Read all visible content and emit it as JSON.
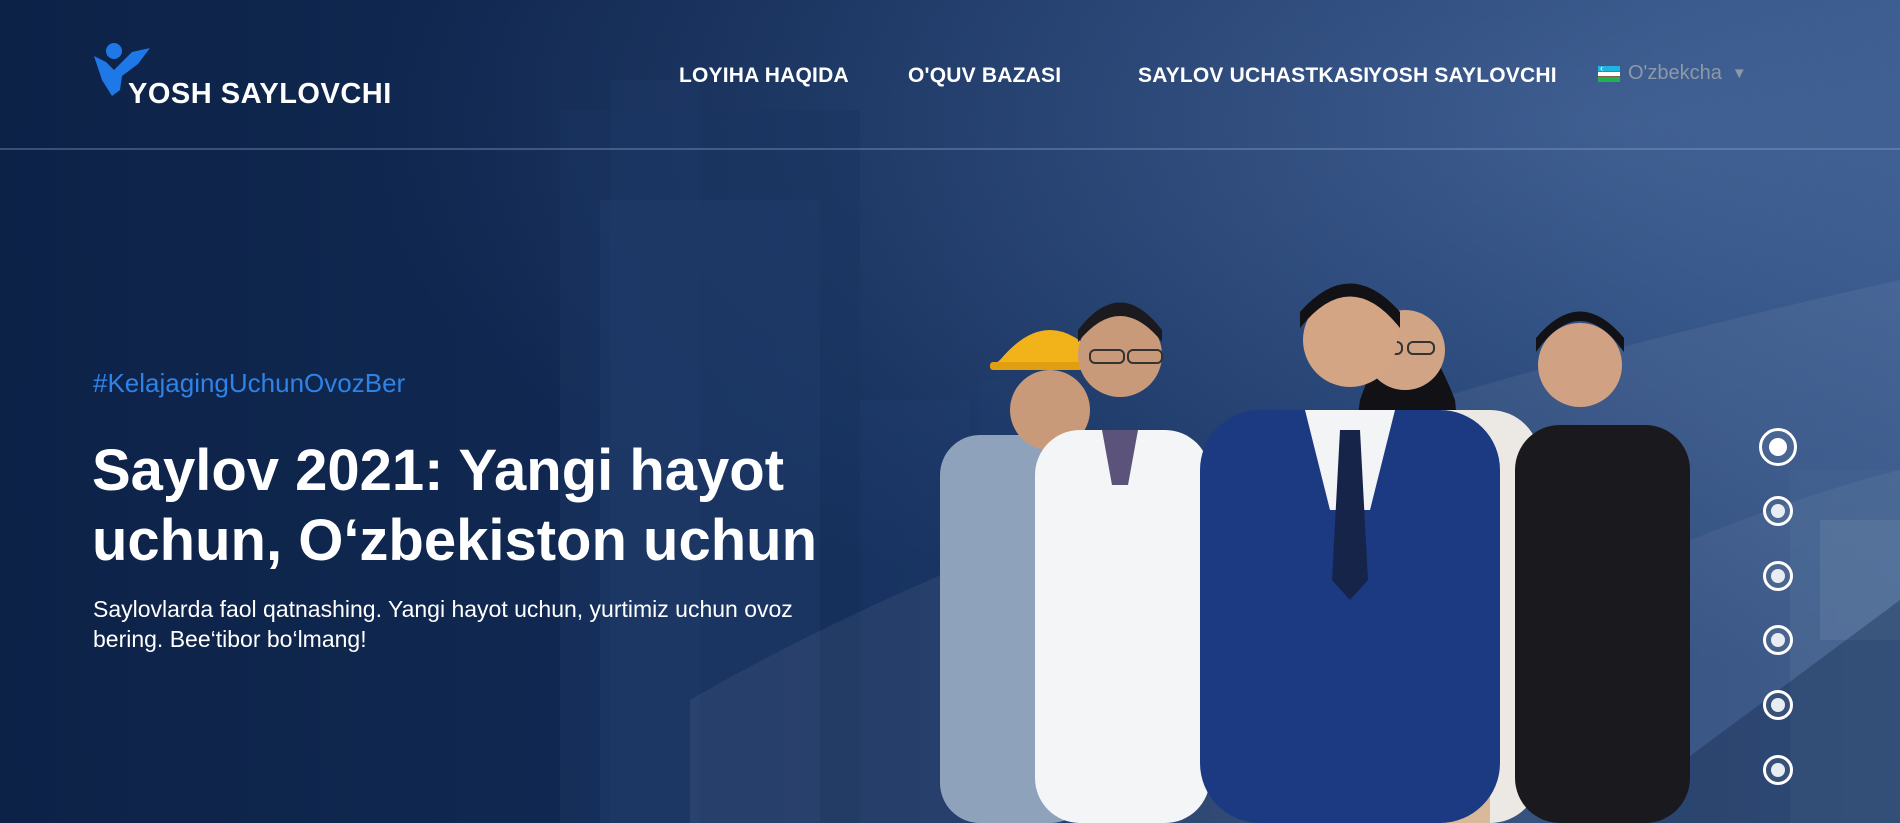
{
  "header": {
    "logo_text": "YOSH SAYLOVCHI",
    "nav": [
      {
        "label": "LOYIHA HAQIDA"
      },
      {
        "label": "O'QUV BAZASI"
      },
      {
        "label": "SAYLOV UCHASTKASI"
      },
      {
        "label": "YOSH SAYLOVCHI"
      }
    ],
    "language": {
      "selected": "O'zbekcha"
    }
  },
  "hero": {
    "hashtag": "#KelajagingUchunOvozBer",
    "title": "Saylov 2021: Yangi hayot uchun, O‘zbekiston uchun",
    "subtitle": "Saylovlarda faol qatnashing. Yangi hayot uchun, yurtimiz uchun ovoz bering. Bee‘tibor bo‘lmang!"
  },
  "slider": {
    "count": 6,
    "active_index": 0
  },
  "colors": {
    "background": "#0e2448",
    "accent": "#2f82e6",
    "logo_blue": "#1f78e8",
    "text": "#ffffff",
    "muted": "#8e99a8"
  }
}
